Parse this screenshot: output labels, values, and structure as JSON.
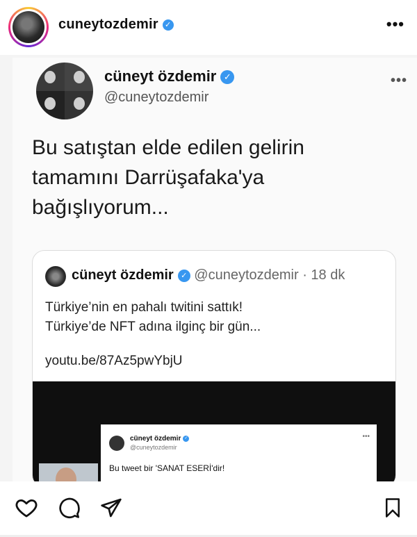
{
  "ig": {
    "username": "cuneytozdemir",
    "more": "•••"
  },
  "tweet": {
    "name": "cüneyt özdemir",
    "handle": "@cuneytozdemir",
    "more": "•••",
    "text_lines": [
      "Bu satıştan elde edilen gelirin",
      "tamamını Darrüşafaka'ya",
      "bağışlıyorum..."
    ]
  },
  "quote": {
    "name": "cüneyt özdemir",
    "handle": "@cuneytozdemir",
    "time": "· 18 dk",
    "lines": [
      "Türkiye’nin en pahalı twitini sattık!",
      "Türkiye’de NFT adına ilginç bir gün..."
    ],
    "link": "youtu.be/87Az5pwYbjU"
  },
  "embed": {
    "name": "cüneyt özdemir",
    "handle": "@cuneytozdemir",
    "more": "•••",
    "text": "Bu tweet bir 'SANAT ESERİ'dir!"
  },
  "icons": {
    "like": "heart-icon",
    "comment": "comment-icon",
    "share": "send-icon",
    "save": "bookmark-icon"
  },
  "colors": {
    "verified": "#3897f0"
  }
}
